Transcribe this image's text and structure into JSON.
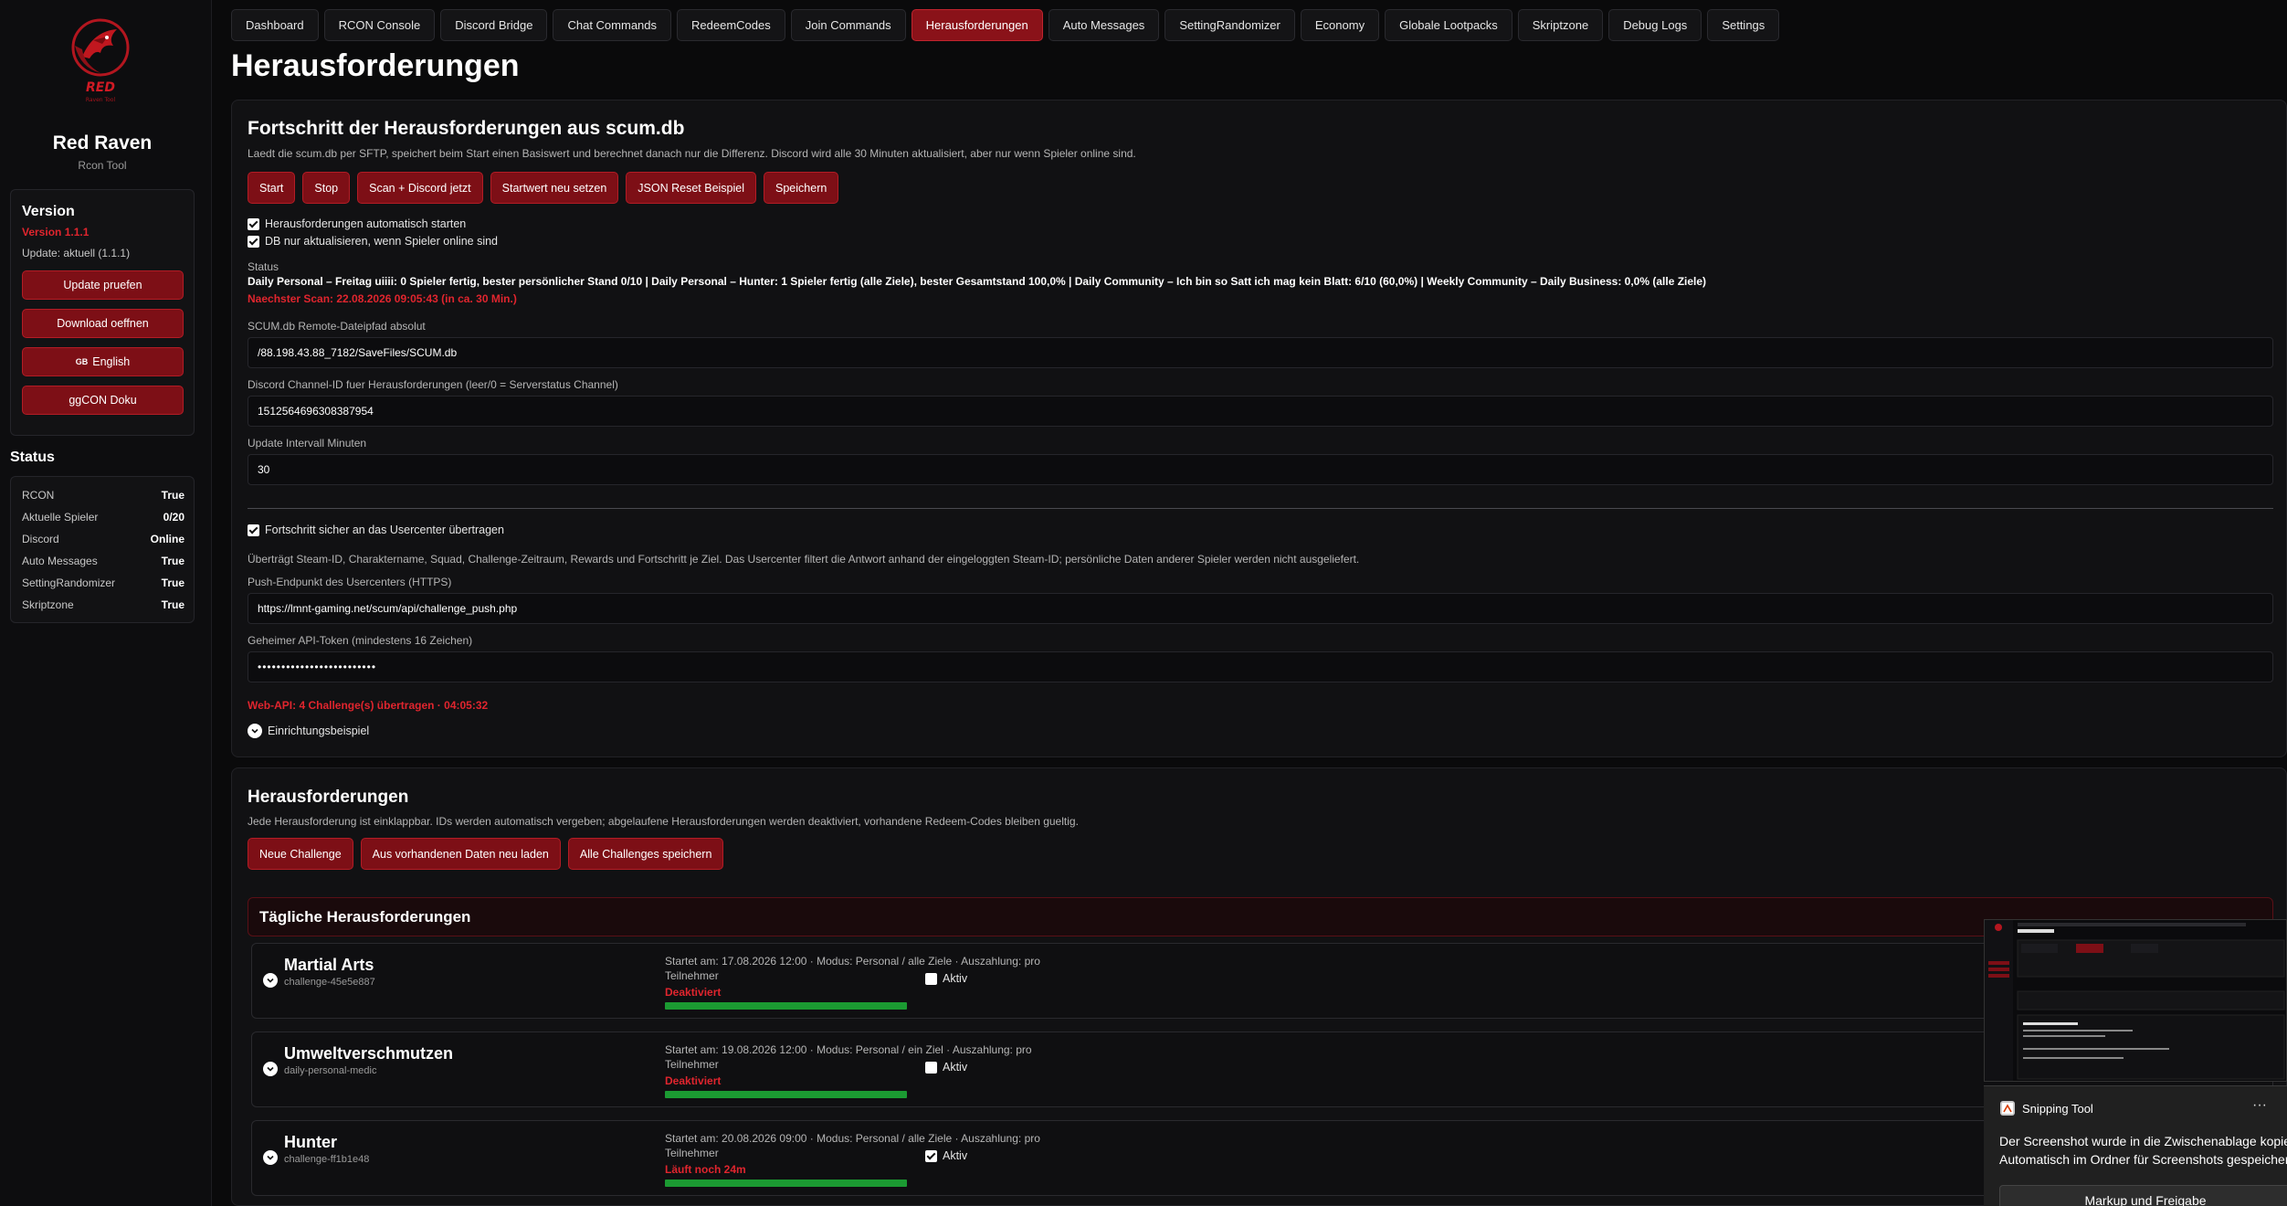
{
  "app": {
    "name": "Red Raven",
    "subtitle": "Rcon Tool",
    "logo_text": "RED",
    "logo_sub": "Raven Tool"
  },
  "version": {
    "heading": "Version",
    "number": "Version 1.1.1",
    "update": "Update: aktuell (1.1.1)",
    "buttons": [
      "Update pruefen",
      "Download oeffnen",
      "English",
      "ggCON Doku"
    ],
    "english_flag": "GB"
  },
  "status": {
    "heading": "Status",
    "rows": [
      {
        "label": "RCON",
        "value": "True"
      },
      {
        "label": "Aktuelle Spieler",
        "value": "0/20"
      },
      {
        "label": "Discord",
        "value": "Online"
      },
      {
        "label": "Auto Messages",
        "value": "True"
      },
      {
        "label": "SettingRandomizer",
        "value": "True"
      },
      {
        "label": "Skriptzone",
        "value": "True"
      }
    ]
  },
  "tabs": [
    "Dashboard",
    "RCON Console",
    "Discord Bridge",
    "Chat Commands",
    "RedeemCodes",
    "Join Commands",
    "Herausforderungen",
    "Auto Messages",
    "SettingRandomizer",
    "Economy",
    "Globale Lootpacks",
    "Skriptzone",
    "Debug Logs",
    "Settings"
  ],
  "active_tab": "Herausforderungen",
  "page_title": "Herausforderungen",
  "progress_panel": {
    "title": "Fortschritt der Herausforderungen aus scum.db",
    "description": "Laedt die scum.db per SFTP, speichert beim Start einen Basiswert und berechnet danach nur die Differenz. Discord wird alle 30 Minuten aktualisiert, aber nur wenn Spieler online sind.",
    "buttons": [
      "Start",
      "Stop",
      "Scan + Discord jetzt",
      "Startwert neu setzen",
      "JSON Reset Beispiel",
      "Speichern"
    ],
    "checkbox_autostart": "Herausforderungen automatisch starten",
    "checkbox_db_online": "DB nur aktualisieren, wenn Spieler online sind",
    "status_label": "Status",
    "status_text": "Daily Personal – Freitag uiiii: 0 Spieler fertig, bester persönlicher Stand 0/10 | Daily Personal – Hunter: 1 Spieler fertig (alle Ziele), bester Gesamtstand 100,0% | Daily Community – Ich bin so Satt ich mag kein Blatt: 6/10 (60,0%) | Weekly Community – Daily Business: 0,0% (alle Ziele)",
    "next_scan": "Naechster Scan: 22.08.2026 09:05:43 (in ca. 30 Min.)",
    "remote_path_label": "SCUM.db Remote-Dateipfad absolut",
    "remote_path_value": "/88.198.43.88_7182/SaveFiles/SCUM.db",
    "channel_label": "Discord Channel-ID fuer Herausforderungen (leer/0 = Serverstatus Channel)",
    "channel_value": "1512564696308387954",
    "interval_label": "Update Intervall Minuten",
    "interval_value": "30",
    "checkbox_usercenter": "Fortschritt sicher an das Usercenter übertragen",
    "usercenter_desc": "Überträgt Steam-ID, Charaktername, Squad, Challenge-Zeitraum, Rewards und Fortschritt je Ziel. Das Usercenter filtert die Antwort anhand der eingeloggten Steam-ID; persönliche Daten anderer Spieler werden nicht ausgeliefert.",
    "push_label": "Push-Endpunkt des Usercenters (HTTPS)",
    "push_value": "https://lmnt-gaming.net/scum/api/challenge_push.php",
    "token_label": "Geheimer API-Token (mindestens 16 Zeichen)",
    "token_value": "•••••••••••••••••••••••••",
    "webapi_status": "Web-API: 4 Challenge(s) übertragen · 04:05:32",
    "example_label": "Einrichtungsbeispiel"
  },
  "challenges_panel": {
    "title": "Herausforderungen",
    "description": "Jede Herausforderung ist einklappbar. IDs werden automatisch vergeben; abgelaufene Herausforderungen werden deaktiviert, vorhandene Redeem-Codes bleiben gueltig.",
    "buttons": [
      "Neue Challenge",
      "Aus vorhandenen Daten neu laden",
      "Alle Challenges speichern"
    ],
    "section_title": "Tägliche Herausforderungen",
    "aktiv_label": "Aktiv",
    "items": [
      {
        "name": "Martial Arts",
        "id": "challenge-45e5e887",
        "meta": "Startet am: 17.08.2026 12:00  ·  Modus: Personal / alle Ziele  ·  Auszahlung: pro Teilnehmer",
        "state": "Deaktiviert",
        "aktiv": false,
        "progress": 1.0
      },
      {
        "name": "Umweltverschmutzen",
        "id": "daily-personal-medic",
        "meta": "Startet am: 19.08.2026 12:00  ·  Modus: Personal / ein Ziel  ·  Auszahlung: pro Teilnehmer",
        "state": "Deaktiviert",
        "aktiv": false,
        "progress": 1.0
      },
      {
        "name": "Hunter",
        "id": "challenge-ff1b1e48",
        "meta": "Startet am: 20.08.2026 09:00  ·  Modus: Personal / alle Ziele  ·  Auszahlung: pro Teilnehmer",
        "state": "Läuft noch 24m",
        "aktiv": true,
        "progress": 1.0
      }
    ]
  },
  "snipping_tool": {
    "title": "Snipping Tool",
    "menu": "···",
    "message1": "Der Screenshot wurde in die Zwischenablage kopiert.",
    "message2": "Automatisch im Ordner für Screenshots gespeichert.",
    "button": "Markup und Freigabe"
  },
  "colors": {
    "accent": "#8a1219",
    "accent_border": "#b31c25",
    "error_text": "#e0252e",
    "progress": "#1b9a32",
    "background": "#0a0a0b"
  }
}
